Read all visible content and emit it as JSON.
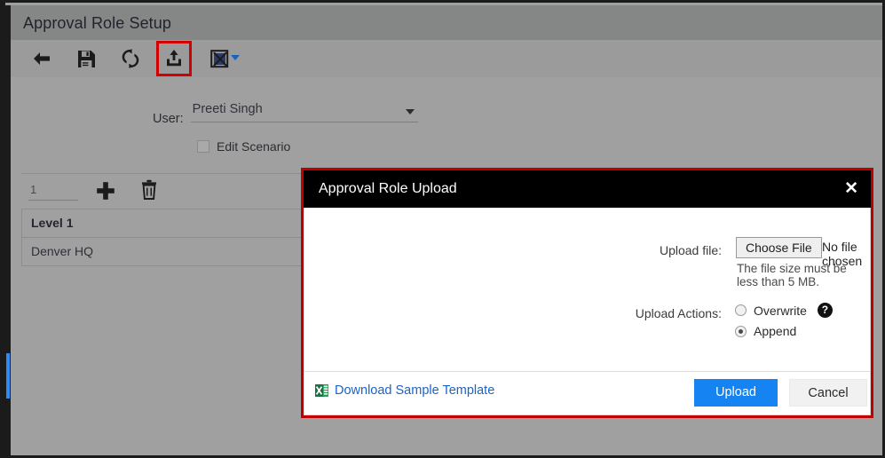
{
  "window": {
    "title": "Approval Role Setup"
  },
  "toolbar": {
    "items": [
      {
        "name": "back-icon",
        "tooltip": "Back"
      },
      {
        "name": "save-icon",
        "tooltip": "Save"
      },
      {
        "name": "refresh-icon",
        "tooltip": "Refresh"
      },
      {
        "name": "upload-icon",
        "tooltip": "Upload"
      },
      {
        "name": "excel-export-icon",
        "tooltip": "Export to Excel"
      }
    ],
    "highlight_color": "#d20000"
  },
  "form": {
    "user_label": "User:",
    "user_value": "Preeti Singh",
    "edit_scenario_label": "Edit Scenario",
    "edit_scenario_checked": false
  },
  "grid_toolbar": {
    "row_count_value": "1",
    "add_label": "+",
    "delete_label": "delete"
  },
  "grid": {
    "headers": [
      "Level 1"
    ],
    "rows": [
      [
        "Denver HQ"
      ]
    ]
  },
  "modal": {
    "title": "Approval Role Upload",
    "close_label": "✕",
    "upload_file_label": "Upload file:",
    "choose_file_button": "Choose File",
    "no_file_chosen": "No file chosen",
    "file_size_hint": "The file size must be less than 5 MB.",
    "upload_actions_label": "Upload Actions:",
    "radios": [
      {
        "label": "Overwrite",
        "checked": false
      },
      {
        "label": "Append",
        "checked": true
      }
    ],
    "help_icon_label": "?",
    "download_sample_link": "Download Sample Template",
    "upload_button": "Upload",
    "cancel_button": "Cancel",
    "primary_color": "#1584f2",
    "annotation_color": "#c00000"
  }
}
